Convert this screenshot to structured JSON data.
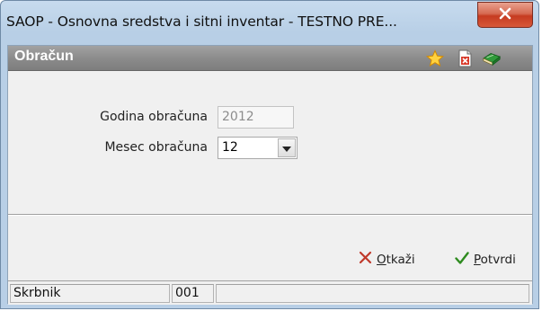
{
  "window": {
    "title": "SAOP -  Osnovna sredstva i sitni inventar - TESTNO PRE...",
    "close_glyph": "✕"
  },
  "header": {
    "title": "Obračun",
    "icons": [
      "star-icon",
      "pdf-delete-icon",
      "book-icon"
    ]
  },
  "form": {
    "year_label": "Godina obračuna",
    "year_value": "2012",
    "month_label": "Mesec obračuna",
    "month_value": "12"
  },
  "actions": {
    "cancel_prefix": "",
    "cancel_ul": "O",
    "cancel_rest": "tkaži",
    "confirm_ul": "P",
    "confirm_rest": "otvrdi"
  },
  "status": {
    "user": "Skrbnik",
    "code": "001",
    "extra": ""
  },
  "colors": {
    "header_bg": "#8c8c8c",
    "close_btn": "#c63b20",
    "cancel_x": "#c0392b",
    "confirm_check": "#2e8b1f"
  }
}
